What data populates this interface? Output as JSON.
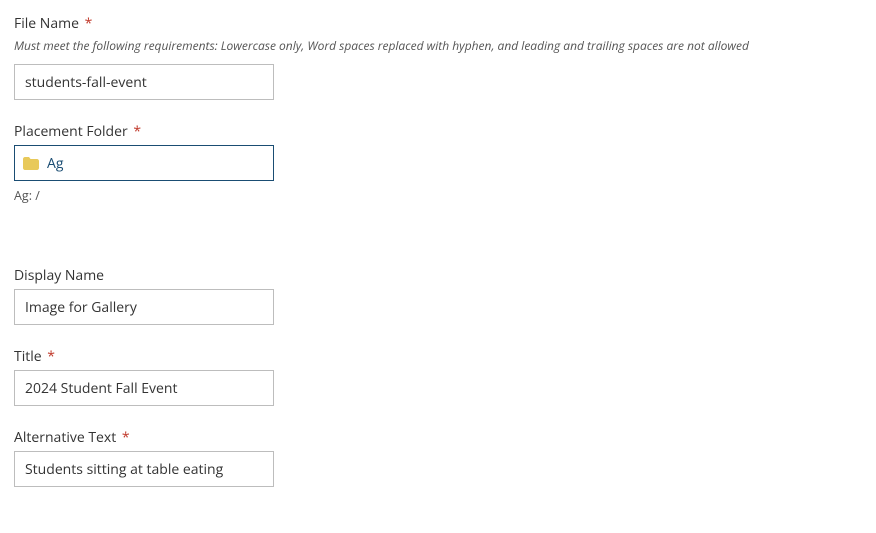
{
  "fileName": {
    "label": "File Name",
    "required": "*",
    "hint": "Must meet the following requirements: Lowercase only, Word spaces replaced with hyphen, and leading and trailing spaces are not allowed",
    "value": "students-fall-event"
  },
  "placementFolder": {
    "label": "Placement Folder",
    "required": "*",
    "value": "Ag",
    "path": "Ag: /"
  },
  "displayName": {
    "label": "Display Name",
    "value": "Image for Gallery"
  },
  "title": {
    "label": "Title",
    "required": "*",
    "value": "2024 Student Fall Event"
  },
  "altText": {
    "label": "Alternative Text",
    "required": "*",
    "value": "Students sitting at table eating"
  }
}
